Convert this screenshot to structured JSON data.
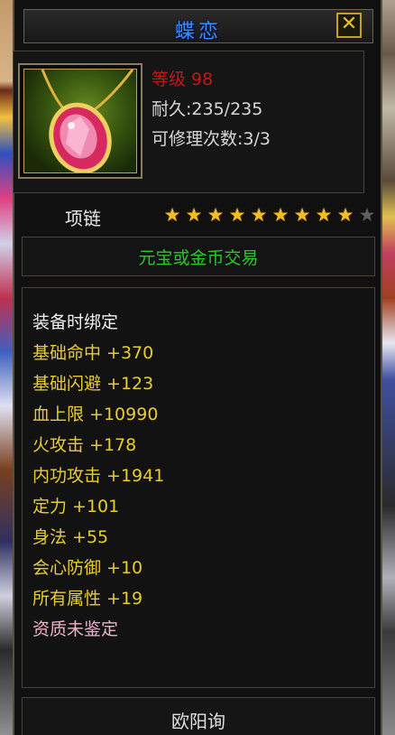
{
  "item": {
    "name": "蝶恋",
    "level_text": "等级 98",
    "durability_text": "耐久:235/235",
    "repair_text": "可修理次数:3/3",
    "type": "项链",
    "stars": {
      "filled": 9,
      "total": 10
    },
    "trade_text": "元宝或金币交易",
    "stats": [
      "装备时绑定",
      "基础命中  +370",
      "基础闪避  +123",
      "血上限  +10990",
      "火攻击  +178",
      "内功攻击  +1941",
      "定力  +101",
      "身法  +55",
      "会心防御  +10",
      "所有属性  +19",
      "资质未鉴定"
    ],
    "maker": "欧阳询"
  },
  "colors": {
    "title": "#3a8cff",
    "level": "#c01818",
    "trade": "#28c828",
    "stat_yellow": "#e8cc30",
    "unidentified": "#f0b0c8",
    "star": "#f0c020"
  },
  "icons": {
    "close": "close-x-icon",
    "item": "pink-gem-necklace-icon"
  }
}
